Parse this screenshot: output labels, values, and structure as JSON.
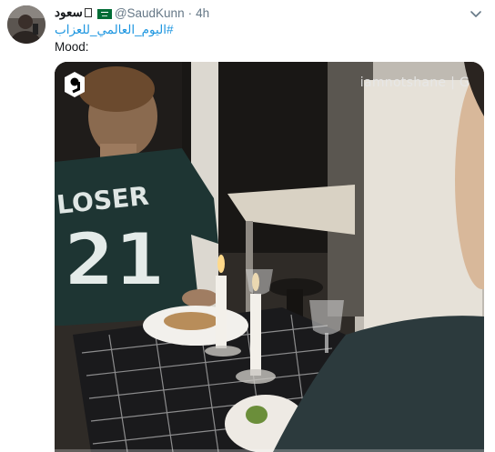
{
  "tweet": {
    "display_name": "سعود",
    "handle": "@SaudKunn",
    "dot": "·",
    "time": "4h",
    "hashtag": "#اليوم_العالمي_للعزاب",
    "text": "Mood:"
  },
  "media": {
    "watermark": "iamnotshane | G",
    "jersey_text": "LOSER",
    "jersey_number": "21",
    "progress": 0
  },
  "icons": {
    "flag": "saudi-flag-icon",
    "box": "unknown-glyph-icon",
    "chevron": "chevron-down-icon",
    "logo": "9gag-logo-icon"
  },
  "colors": {
    "link": "#1b95e0",
    "secondary": "#657786",
    "flag_green": "#006c35"
  }
}
